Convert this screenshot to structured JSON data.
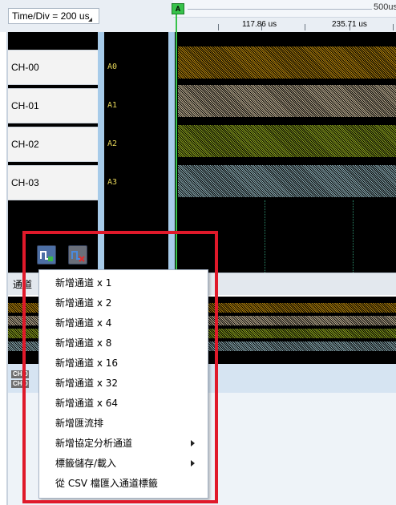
{
  "toolbar": {
    "time_div": "Time/Div = 200 us",
    "ruler_tick_1": "117.86 us",
    "ruler_tick_2": "235.71 us",
    "ruler_overview_label": "500us",
    "marker_label": "A"
  },
  "channels": [
    {
      "name": "CH-00",
      "alias": "A0",
      "color": "#b8860b"
    },
    {
      "name": "CH-01",
      "alias": "A1",
      "color": "#c8b89a"
    },
    {
      "name": "CH-02",
      "alias": "A2",
      "color": "#8fa61e"
    },
    {
      "name": "CH-03",
      "alias": "A3",
      "color": "#8fb0b8"
    }
  ],
  "row_bar_label": "通道",
  "mini_channels": [
    "CH-0",
    "CH-0"
  ],
  "context_menu": {
    "items": [
      {
        "label": "新增通道 x 1"
      },
      {
        "label": "新增通道 x 2"
      },
      {
        "label": "新增通道 x 4"
      },
      {
        "label": "新增通道 x 8"
      },
      {
        "label": "新增通道 x 16"
      },
      {
        "label": "新增通道 x 32"
      },
      {
        "label": "新增通道 x 64"
      },
      {
        "label": "新增匯流排"
      },
      {
        "label": "新增協定分析通道",
        "submenu": true
      },
      {
        "label": "標籤儲存/載入",
        "submenu": true
      },
      {
        "label": "從 CSV 檔匯入通道標籤"
      }
    ]
  },
  "icons": {
    "add_channel": "add-channel-icon",
    "delete_channel": "delete-channel-icon"
  },
  "colors": {
    "marker": "#37c24a",
    "highlight": "#e0192a",
    "accent_blue": "#a7cbe9"
  }
}
